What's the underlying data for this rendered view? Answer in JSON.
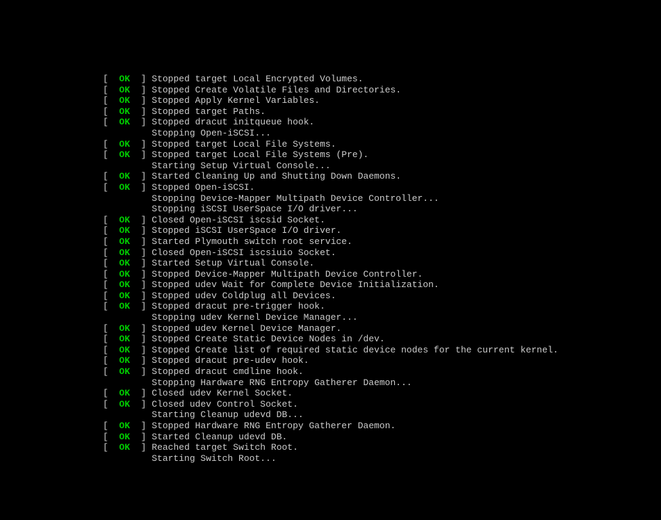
{
  "lines": [
    {
      "status": "OK",
      "message": "Stopped target Local Encrypted Volumes."
    },
    {
      "status": "OK",
      "message": "Stopped Create Volatile Files and Directories."
    },
    {
      "status": "OK",
      "message": "Stopped Apply Kernel Variables."
    },
    {
      "status": "OK",
      "message": "Stopped target Paths."
    },
    {
      "status": "OK",
      "message": "Stopped dracut initqueue hook."
    },
    {
      "status": null,
      "message": "Stopping Open-iSCSI..."
    },
    {
      "status": "OK",
      "message": "Stopped target Local File Systems."
    },
    {
      "status": "OK",
      "message": "Stopped target Local File Systems (Pre)."
    },
    {
      "status": null,
      "message": "Starting Setup Virtual Console..."
    },
    {
      "status": "OK",
      "message": "Started Cleaning Up and Shutting Down Daemons."
    },
    {
      "status": "OK",
      "message": "Stopped Open-iSCSI."
    },
    {
      "status": null,
      "message": "Stopping Device-Mapper Multipath Device Controller..."
    },
    {
      "status": null,
      "message": "Stopping iSCSI UserSpace I/O driver..."
    },
    {
      "status": "OK",
      "message": "Closed Open-iSCSI iscsid Socket."
    },
    {
      "status": "OK",
      "message": "Stopped iSCSI UserSpace I/O driver."
    },
    {
      "status": "OK",
      "message": "Started Plymouth switch root service."
    },
    {
      "status": "OK",
      "message": "Closed Open-iSCSI iscsiuio Socket."
    },
    {
      "status": "OK",
      "message": "Started Setup Virtual Console."
    },
    {
      "status": "OK",
      "message": "Stopped Device-Mapper Multipath Device Controller."
    },
    {
      "status": "OK",
      "message": "Stopped udev Wait for Complete Device Initialization."
    },
    {
      "status": "OK",
      "message": "Stopped udev Coldplug all Devices."
    },
    {
      "status": "OK",
      "message": "Stopped dracut pre-trigger hook."
    },
    {
      "status": null,
      "message": "Stopping udev Kernel Device Manager..."
    },
    {
      "status": "OK",
      "message": "Stopped udev Kernel Device Manager."
    },
    {
      "status": "OK",
      "message": "Stopped Create Static Device Nodes in /dev."
    },
    {
      "status": "OK",
      "message": "Stopped Create list of required static device nodes for the current kernel."
    },
    {
      "status": "OK",
      "message": "Stopped dracut pre-udev hook."
    },
    {
      "status": "OK",
      "message": "Stopped dracut cmdline hook."
    },
    {
      "status": null,
      "message": "Stopping Hardware RNG Entropy Gatherer Daemon..."
    },
    {
      "status": "OK",
      "message": "Closed udev Kernel Socket."
    },
    {
      "status": "OK",
      "message": "Closed udev Control Socket."
    },
    {
      "status": null,
      "message": "Starting Cleanup udevd DB..."
    },
    {
      "status": "OK",
      "message": "Stopped Hardware RNG Entropy Gatherer Daemon."
    },
    {
      "status": "OK",
      "message": "Started Cleanup udevd DB."
    },
    {
      "status": "OK",
      "message": "Reached target Switch Root."
    },
    {
      "status": null,
      "message": "Starting Switch Root..."
    }
  ],
  "tokens": {
    "open_bracket": "[",
    "close_bracket": "]",
    "status_pad_left": "  ",
    "status_pad_right": "  ",
    "indent_spaces": "         "
  }
}
